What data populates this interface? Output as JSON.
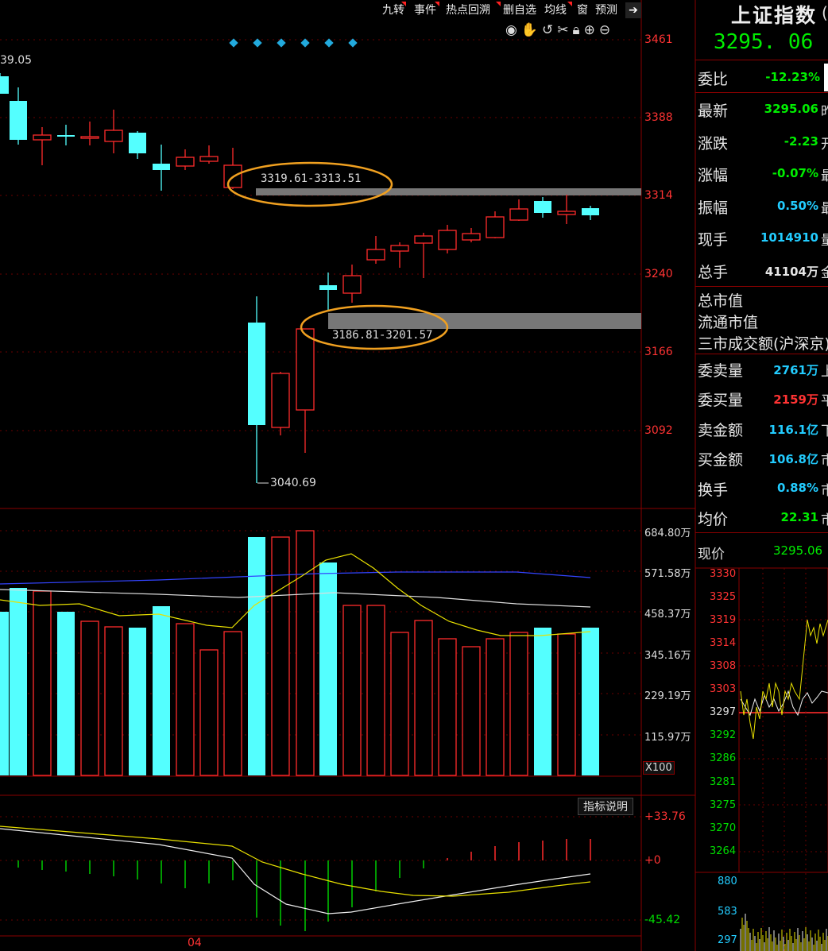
{
  "toolbar": {
    "buttons": [
      "九转",
      "事件",
      "热点回溯",
      "删自选",
      "均线",
      "窗",
      "预测"
    ],
    "icons": [
      "eye-icon",
      "hand-icon",
      "undo-icon",
      "scissors-icon",
      "lock-icon",
      "zoom-in-icon",
      "zoom-out-icon",
      "collapse-arrow-icon"
    ]
  },
  "kline": {
    "price_axis": [
      "3461",
      "3388",
      "3314",
      "3240",
      "3166",
      "3092"
    ],
    "high_label": "39.05",
    "low_label": "3040.69",
    "gap_upper_label": "3319.61-3313.51",
    "gap_lower_label": "3186.81-3201.57"
  },
  "volume": {
    "axis": [
      "684.80万",
      "571.58万",
      "458.37万",
      "345.16万",
      "229.19万",
      "115.97万"
    ],
    "unit": "X100"
  },
  "macd": {
    "axis": [
      "+33.76",
      "+0",
      "-45.42"
    ],
    "button": "指标说明",
    "date_label": "04"
  },
  "quote": {
    "title": "上证指数",
    "price": "3295. 06",
    "rows": [
      {
        "label": "委比",
        "value": "-12.23%",
        "color": "#00ee00"
      },
      {
        "label": "最新",
        "value": "3295.06",
        "color": "#00ee00",
        "edge": "昨"
      },
      {
        "label": "涨跌",
        "value": "-2.23",
        "color": "#00ee00",
        "edge": "开"
      },
      {
        "label": "涨幅",
        "value": "-0.07%",
        "color": "#00ee00",
        "edge": "最"
      },
      {
        "label": "振幅",
        "value": "0.50%",
        "color": "#22ccff",
        "edge": "最"
      },
      {
        "label": "现手",
        "value": "1014910",
        "color": "#22ccff",
        "edge": "量"
      },
      {
        "label": "总手",
        "value": "41104万",
        "color": "#e6e6e6",
        "edge": "金"
      }
    ],
    "cap_rows": [
      "总市值",
      "流通市值",
      "三市成交额(沪深京)"
    ],
    "trade_rows": [
      {
        "label": "委卖量",
        "value": "2761万",
        "color": "#22ccff",
        "edge": "上"
      },
      {
        "label": "委买量",
        "value": "2159万",
        "color": "#ff3333",
        "edge": "平"
      },
      {
        "label": "卖金额",
        "value": "116.1亿",
        "color": "#22ccff",
        "edge": "下"
      },
      {
        "label": "买金额",
        "value": "106.8亿",
        "color": "#22ccff",
        "edge": "市"
      },
      {
        "label": "换手",
        "value": "0.88%",
        "color": "#22ccff",
        "edge": "市"
      },
      {
        "label": "均价",
        "value": "22.31",
        "color": "#00ee00",
        "edge": "市"
      }
    ]
  },
  "minichart": {
    "label": "现价",
    "price": "3295.06",
    "price_axis": [
      "3330",
      "3325",
      "3319",
      "3314",
      "3308",
      "3303",
      "3297",
      "3292",
      "3286",
      "3281",
      "3275",
      "3270",
      "3264"
    ],
    "volume_axis": [
      "880",
      "583",
      "297"
    ]
  },
  "colors": {
    "up": "#ff2b2b",
    "down": "#54ffff",
    "grid": "#8a0000",
    "highlight_ellipse": "#f0a020",
    "gap_band": "#777777"
  }
}
